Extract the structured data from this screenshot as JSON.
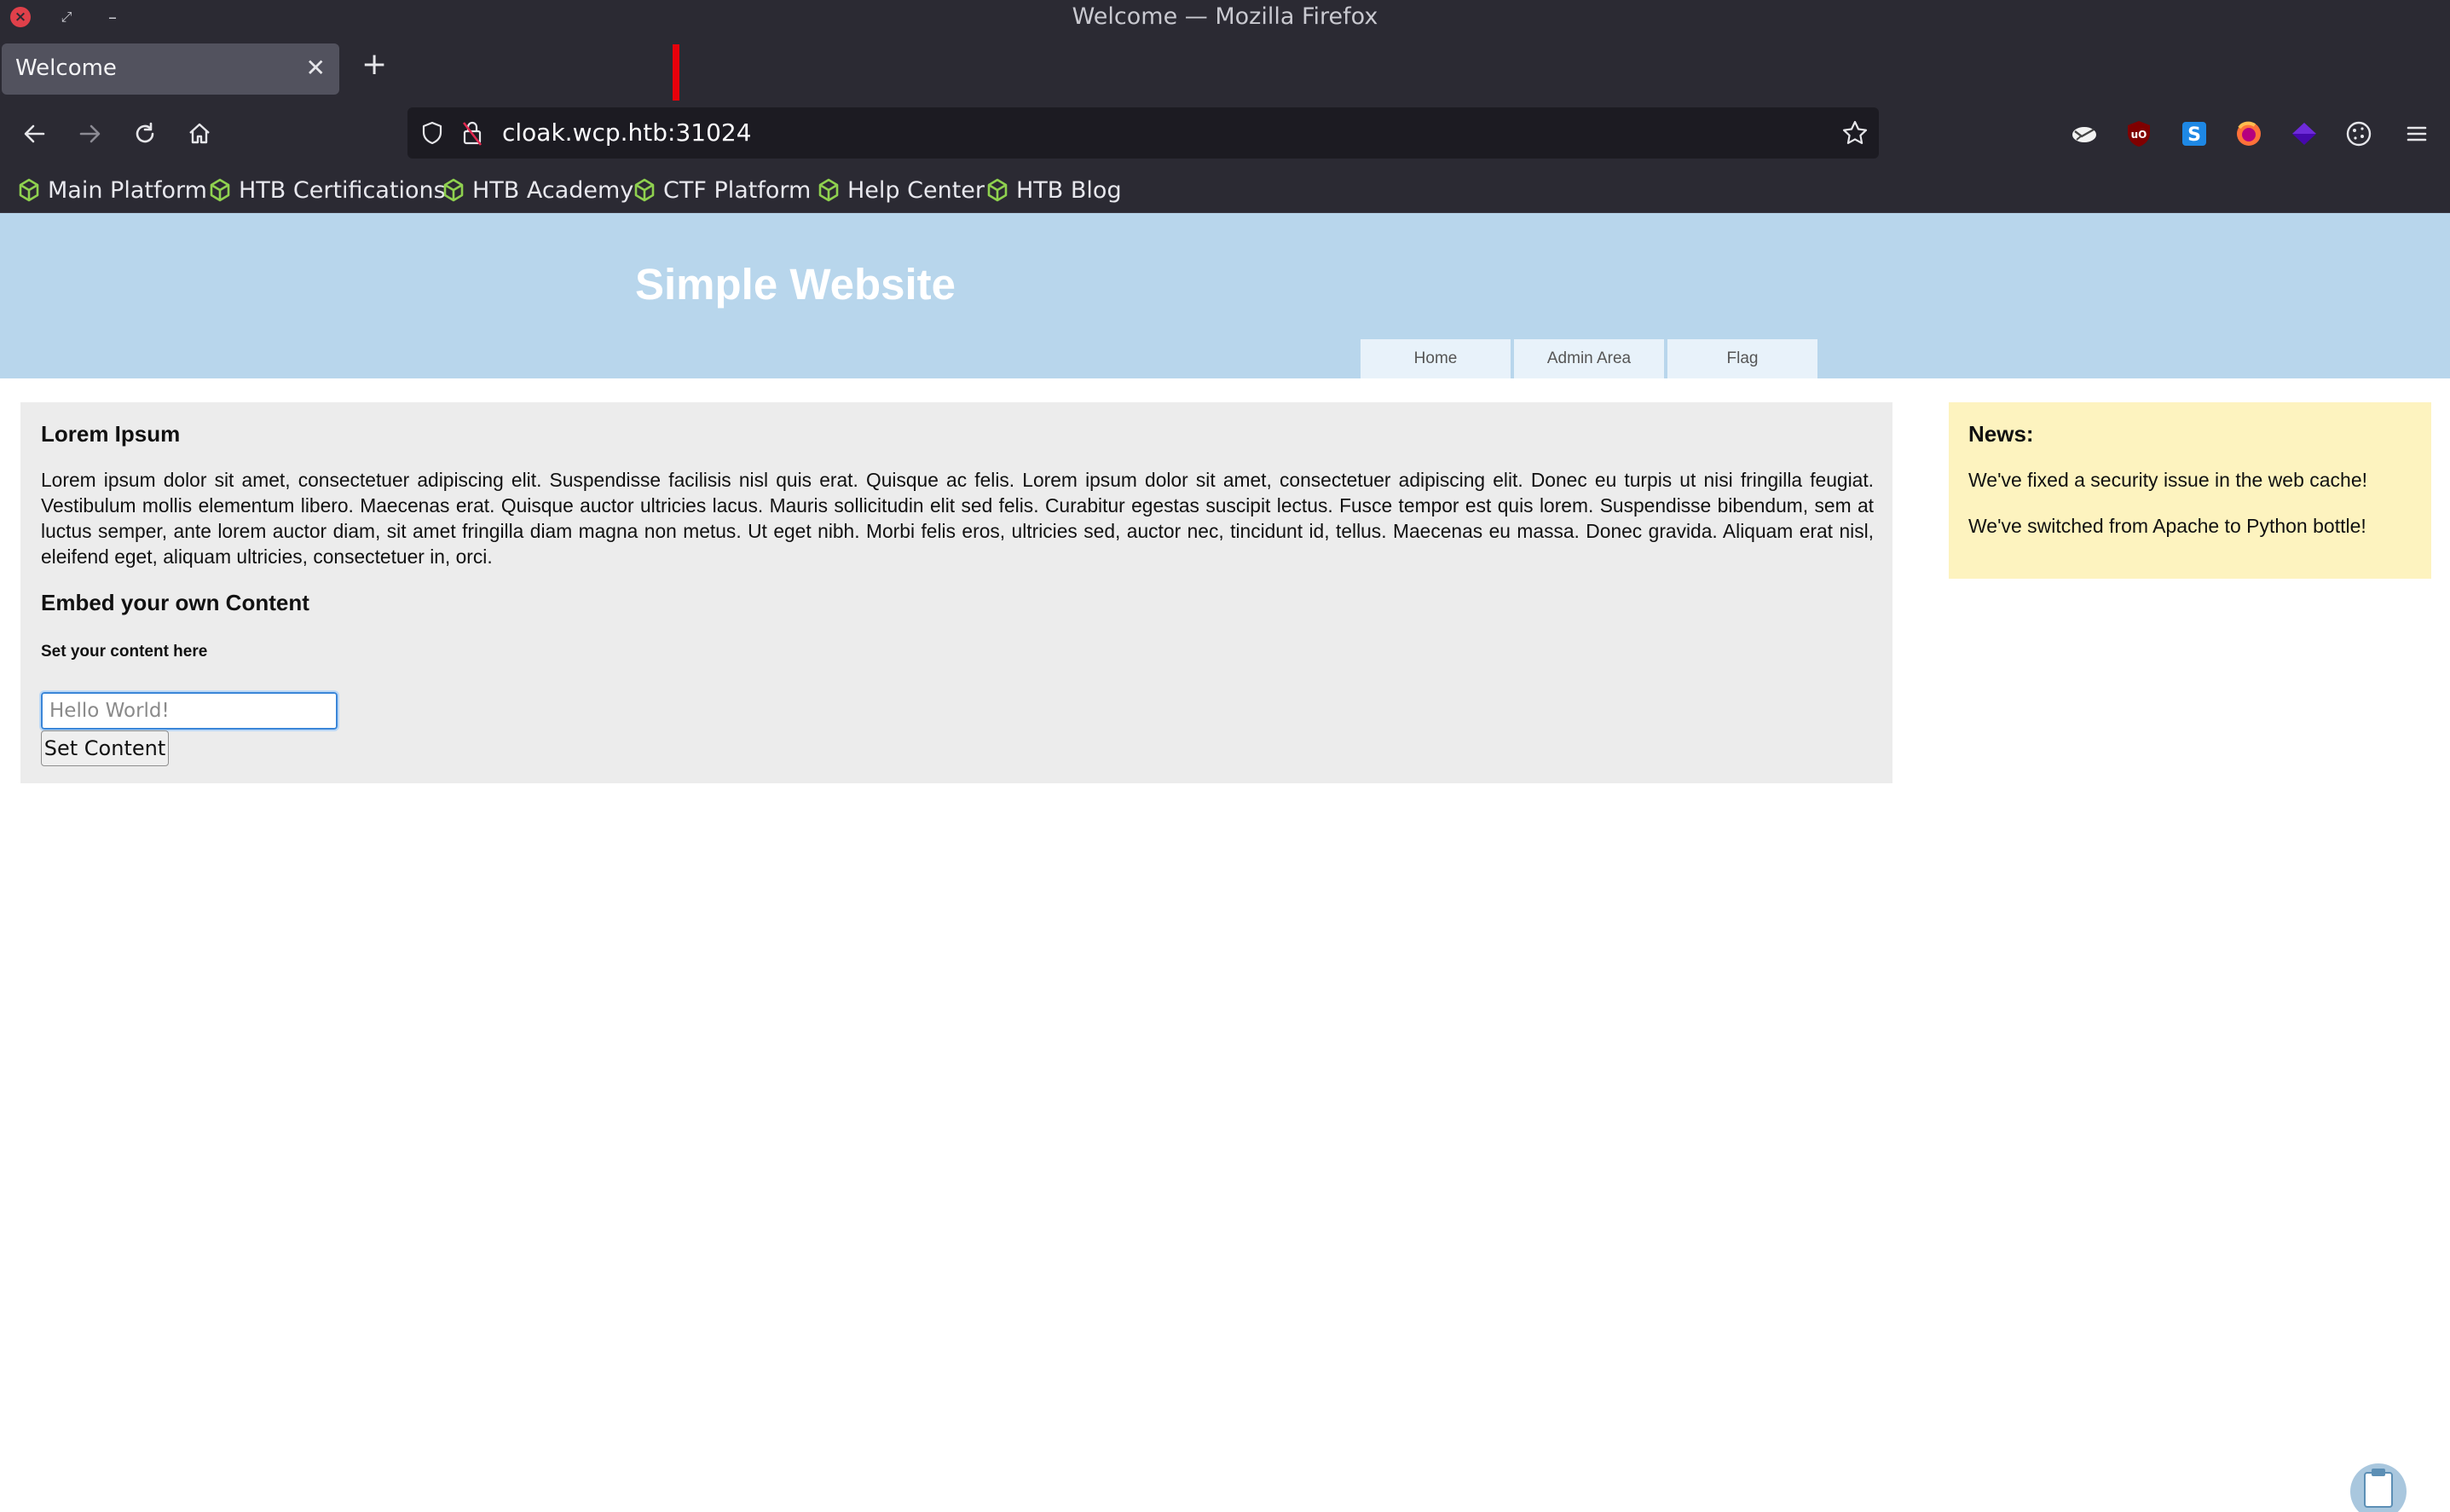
{
  "window": {
    "title": "Welcome — Mozilla Firefox"
  },
  "tabs": [
    {
      "title": "Welcome",
      "close_glyph": "✕"
    }
  ],
  "new_tab_glyph": "+",
  "urlbar": {
    "url": "cloak.wcp.htb:31024"
  },
  "nav_icons": [
    "back-arrow-icon",
    "forward-arrow-icon",
    "reload-icon",
    "home-icon",
    "shield-icon",
    "lock-icon",
    "star-icon"
  ],
  "extensions": [
    "foxyproxy-icon",
    "ublock-origin-icon",
    "s-extension-icon",
    "firefox-account-icon",
    "wappalyzer-icon",
    "cookie-icon",
    "menu-icon"
  ],
  "bookmarks": [
    {
      "label": "Main Platform"
    },
    {
      "label": "HTB Certifications"
    },
    {
      "label": "HTB Academy"
    },
    {
      "label": "CTF Platform"
    },
    {
      "label": "Help Center"
    },
    {
      "label": "HTB Blog"
    }
  ],
  "site": {
    "title": "Simple Website",
    "nav": [
      {
        "label": "Home"
      },
      {
        "label": "Admin Area"
      },
      {
        "label": "Flag"
      }
    ]
  },
  "main": {
    "heading": "Lorem Ipsum",
    "body": "Lorem ipsum dolor sit amet, consectetuer adipiscing elit. Suspendisse facilisis nisl quis erat. Quisque ac felis. Lorem ipsum dolor sit amet, consectetuer adipiscing elit. Donec eu turpis ut nisi fringilla feugiat. Vestibulum mollis elementum libero. Maecenas erat. Quisque auctor ultricies lacus. Mauris sollicitudin elit sed felis. Curabitur egestas suscipit lectus. Fusce tempor est quis lorem. Suspendisse bibendum, sem at luctus semper, ante lorem auctor diam, sit amet fringilla diam magna non metus. Ut eget nibh. Morbi felis eros, ultricies sed, auctor nec, tincidunt id, tellus. Maecenas eu massa. Donec gravida. Aliquam erat nisl, eleifend eget, aliquam ultricies, consectetuer in, orci.",
    "embed_heading": "Embed your own Content",
    "set_label": "Set your content here",
    "input": {
      "placeholder": "Hello World!",
      "value": ""
    },
    "button_label": "Set Content"
  },
  "news": {
    "heading": "News:",
    "items": [
      "We've fixed a security issue in the web cache!",
      "We've switched from Apache to Python bottle!"
    ]
  },
  "colors": {
    "chrome": "#2b2a33",
    "urlbar": "#1c1b22",
    "header": "#b8d6ec",
    "content_bg": "#ececec",
    "news_bg": "#fdf3bf",
    "bookmark_icon": "#8fd14f",
    "annotation_arrow": "#e8000b"
  }
}
